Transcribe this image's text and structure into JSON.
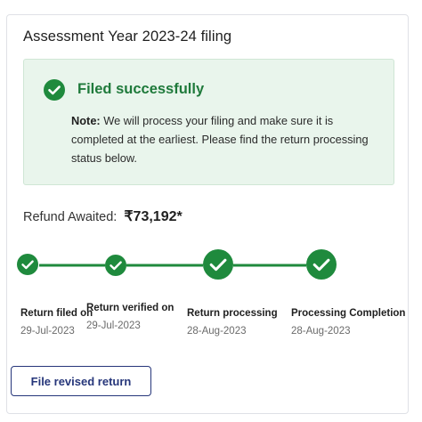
{
  "card": {
    "title": "Assessment Year 2023-24 filing"
  },
  "status": {
    "icon": "check-circle-icon",
    "title": "Filed successfully",
    "note_label": "Note:",
    "note_text": "We will process your filing and make sure it is completed at the earliest. Please find the return processing status below."
  },
  "refund": {
    "label": "Refund Awaited:",
    "amount": "₹73,192*"
  },
  "timeline": {
    "steps": [
      {
        "label": "Return filed on",
        "date": "29-Jul-2023",
        "icon": "check-circle-icon",
        "done": true
      },
      {
        "label": "Return verified on",
        "date": "29-Jul-2023",
        "icon": "check-circle-icon",
        "done": true
      },
      {
        "label": "Return processing",
        "date": "28-Aug-2023",
        "icon": "check-circle-icon",
        "done": true
      },
      {
        "label": "Processing Completion",
        "date": "28-Aug-2023",
        "icon": "check-circle-icon",
        "done": true
      }
    ]
  },
  "actions": {
    "revise_label": "File revised return"
  },
  "colors": {
    "success_green": "#1f8a3d",
    "success_bg": "#e9f5ec",
    "primary_navy": "#26367a"
  }
}
